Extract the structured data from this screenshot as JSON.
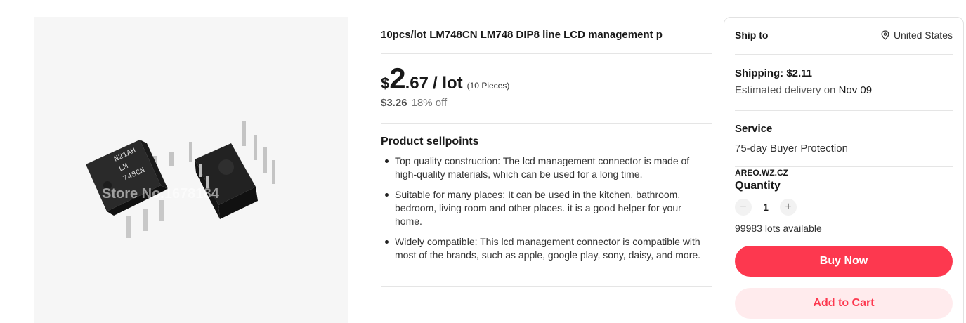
{
  "product": {
    "title": "10pcs/lot LM748CN LM748 DIP8 line LCD management p",
    "image": {
      "chip_marking_line1": "N21AH",
      "chip_marking_line2": "LM",
      "chip_marking_line3": "748CN",
      "watermark": "Store No.1678184"
    }
  },
  "price": {
    "currency": "$",
    "whole": "2",
    "decimal": ".67",
    "unit": "/ lot",
    "pieces": "(10 Pieces)",
    "original": "$3.26",
    "discount": "18% off"
  },
  "sellpoints": {
    "heading": "Product sellpoints",
    "items": [
      "Top quality construction: The lcd management connector is made of high-quality materials, which can be used for a long time.",
      "Suitable for many places: It can be used in the kitchen, bathroom, bedroom, living room and other places. it is a good helper for your home.",
      "Widely compatible: This lcd management connector is compatible with most of the brands, such as apple, google play, sony, daisy, and more."
    ]
  },
  "card": {
    "ship_to_label": "Ship to",
    "ship_to_country": "United States",
    "shipping": "Shipping: $2.11",
    "delivery_prefix": "Estimated delivery on",
    "delivery_date": "Nov 09",
    "service_heading": "Service",
    "service_value": "75-day Buyer Protection",
    "store_name": "AREO.WZ.CZ",
    "quantity_heading": "Quantity",
    "quantity_minus": "−",
    "quantity_value": "1",
    "quantity_plus": "+",
    "available": "99983 lots available",
    "buy_now": "Buy Now",
    "add_to_cart": "Add to Cart"
  },
  "colors": {
    "accent": "#fd384f",
    "accent_light": "#ffebed"
  },
  "icons": {
    "location": "location-pin-icon"
  }
}
